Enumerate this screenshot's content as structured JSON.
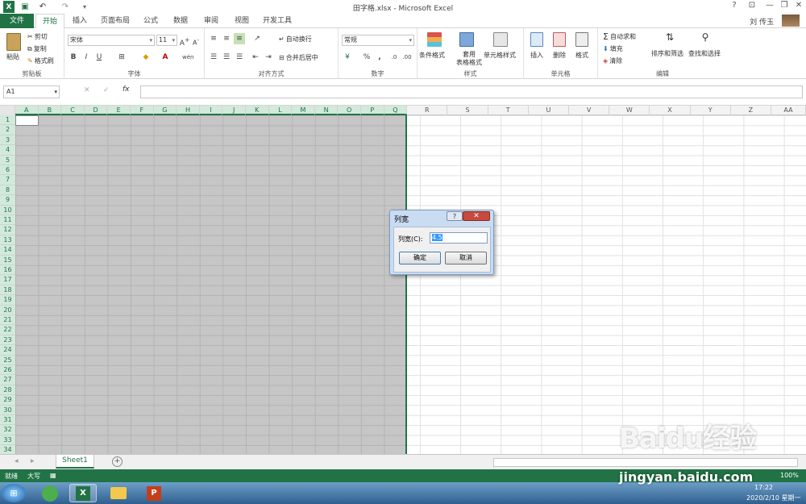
{
  "window": {
    "title": "田字格.xlsx - Microsoft Excel",
    "help": "?",
    "minimize": "—",
    "restore": "❐",
    "close": "✕"
  },
  "qat": {
    "undo": "↶",
    "redo": "↷",
    "save": "💾"
  },
  "tabs": [
    "文件",
    "开始",
    "插入",
    "页面布局",
    "公式",
    "数据",
    "审阅",
    "视图",
    "开发工具"
  ],
  "user": "刘 传玉",
  "ribbon": {
    "clipboard": {
      "paste": "粘贴",
      "cut": "剪切",
      "copy": "复制",
      "format_painter": "格式刷",
      "label": "剪贴板"
    },
    "font": {
      "name": "宋体",
      "size": "11",
      "bold": "B",
      "italic": "I",
      "underline": "U",
      "label": "字体"
    },
    "alignment": {
      "wrap": "自动换行",
      "merge": "合并后居中",
      "label": "对齐方式"
    },
    "number": {
      "format": "常规",
      "percent": "%",
      "comma": ",",
      "label": "数字"
    },
    "styles": {
      "conditional": "条件格式",
      "table": "套用\n表格格式",
      "cell": "单元格样式",
      "label": "样式"
    },
    "cells": {
      "insert": "插入",
      "delete": "删除",
      "format": "格式",
      "label": "单元格"
    },
    "editing": {
      "autosum": "自动求和",
      "fill": "填充",
      "clear": "清除",
      "sort": "排序和筛选",
      "find": "查找和选择",
      "label": "编辑"
    }
  },
  "formula_bar": {
    "namebox": "A1",
    "cancel": "✕",
    "confirm": "✓",
    "fx": "fx"
  },
  "columns": [
    "A",
    "B",
    "C",
    "D",
    "E",
    "F",
    "G",
    "H",
    "I",
    "J",
    "K",
    "L",
    "M",
    "N",
    "O",
    "P",
    "Q",
    "R",
    "S",
    "T",
    "U",
    "V",
    "W",
    "X",
    "Y",
    "Z",
    "AA"
  ],
  "rows": [
    "1",
    "2",
    "3",
    "4",
    "5",
    "6",
    "7",
    "8",
    "9",
    "10",
    "11",
    "12",
    "13",
    "14",
    "15",
    "16",
    "17",
    "18",
    "19",
    "20",
    "21",
    "22",
    "23",
    "24",
    "25",
    "26",
    "27",
    "28",
    "29",
    "30",
    "31",
    "32",
    "33",
    "34"
  ],
  "dialog": {
    "title": "列宽",
    "label": "列宽(C):",
    "value": "4.5",
    "ok": "确定",
    "cancel": "取消",
    "help": "?",
    "close": "✕"
  },
  "sheet": {
    "tab": "Sheet1",
    "add": "+"
  },
  "status": {
    "ready": "就绪",
    "caps": "大写",
    "zoom": "100%"
  },
  "taskbar": {
    "time": "17:22",
    "date": "2020/2/10 星期一"
  },
  "watermark": {
    "brand": "Baidu经验",
    "url": "jingyan.baidu.com"
  }
}
